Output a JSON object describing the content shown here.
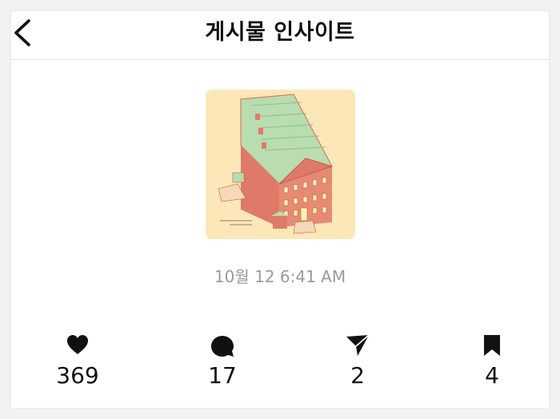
{
  "header": {
    "title": "게시물 인사이트",
    "back_icon": "chevron-left-icon"
  },
  "post": {
    "thumbnail": "building-illustration",
    "timestamp": "10월 12 6:41 AM"
  },
  "stats": [
    {
      "icon": "heart-icon",
      "value": "369"
    },
    {
      "icon": "comment-icon",
      "value": "17"
    },
    {
      "icon": "share-icon",
      "value": "2"
    },
    {
      "icon": "bookmark-icon",
      "value": "4"
    }
  ],
  "colors": {
    "thumb_bg": "#fbe7b8",
    "roof_green": "#b9dcb0",
    "brick": "#e07a68"
  }
}
